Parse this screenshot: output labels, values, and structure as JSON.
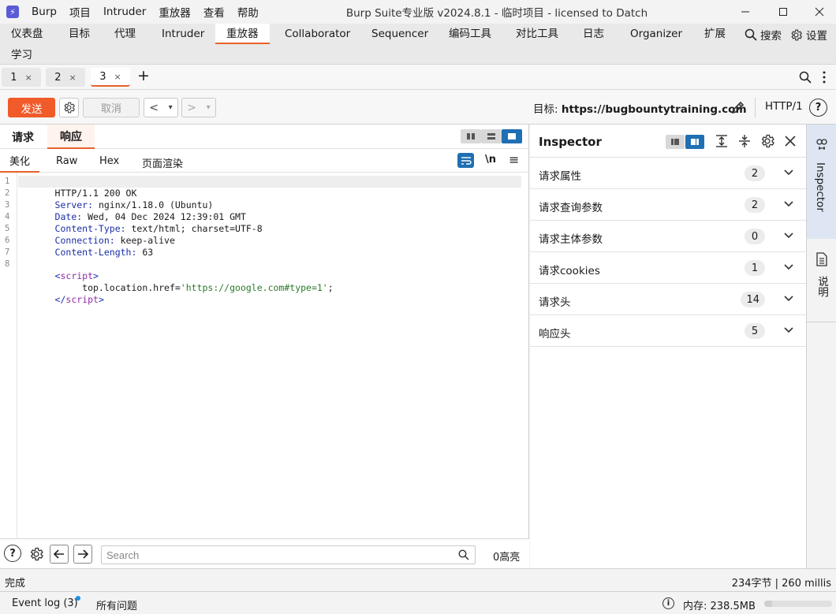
{
  "app": {
    "logo_glyph": "⚡",
    "menu": [
      "Burp",
      "项目",
      "Intruder",
      "重放器",
      "查看",
      "帮助"
    ],
    "window_title": "Burp Suite专业版  v2024.8.1 - 临时项目 - licensed to Datch"
  },
  "tool_tabs": [
    "仪表盘",
    "目标",
    "代理",
    "Intruder",
    "重放器",
    "Collaborator",
    "Sequencer",
    "编码工具",
    "对比工具",
    "日志",
    "Organizer",
    "扩展"
  ],
  "tool_tab_active": "重放器",
  "tool_learn": "学习",
  "search_label": "搜索",
  "settings_label": "设置",
  "repeater_tabs": [
    {
      "label": "1",
      "close": "×"
    },
    {
      "label": "2",
      "close": "×"
    },
    {
      "label": "3",
      "close": "×"
    }
  ],
  "add_tab": "+",
  "toolbar": {
    "send": "发送",
    "cancel": "取消",
    "back": "<",
    "back_menu": "▾",
    "forward": ">",
    "forward_menu": "▾",
    "target_prefix": "目标: ",
    "target_url": "https://bugbountytraining.com",
    "http_version": "HTTP/1",
    "help": "?"
  },
  "message_tabs": {
    "request": "请求",
    "response": "响应",
    "active": "响应"
  },
  "format_tabs": {
    "pretty": "美化",
    "raw": "Raw",
    "hex": "Hex",
    "render": "页面渲染",
    "newline": "\\n",
    "menu": "≡"
  },
  "editor": {
    "line_numbers": [
      "1",
      "2",
      "3",
      "4",
      "5",
      "6",
      "7",
      "8"
    ],
    "lines": [
      {
        "prefix": "HTTP/1.1 200 OK",
        "rest": ""
      },
      {
        "prefix": "Server:",
        "rest": " nginx/1.18.0 (Ubuntu)"
      },
      {
        "prefix": "Date:",
        "rest": " Wed, 04 Dec 2024 12:39:01 GMT"
      },
      {
        "prefix": "Content-Type:",
        "rest": " text/html; charset=UTF-8"
      },
      {
        "prefix": "Connection:",
        "rest": " keep-alive"
      },
      {
        "prefix": "Content-Length:",
        "rest": " 63"
      },
      {
        "prefix": "",
        "rest": ""
      },
      {
        "prefix": "<",
        "tag": "script",
        "suffix": ">"
      },
      {
        "indent": "     top.location.href=",
        "string": "'https://google.com#type=1'",
        "end": ";"
      },
      {
        "prefix": "</",
        "tag": "script",
        "suffix": ">"
      }
    ]
  },
  "search": {
    "placeholder": "Search",
    "highlights": "0高亮"
  },
  "inspector": {
    "title": "Inspector",
    "rows": [
      {
        "label": "请求属性",
        "count": "2"
      },
      {
        "label": "请求查询参数",
        "count": "2"
      },
      {
        "label": "请求主体参数",
        "count": "0"
      },
      {
        "label": "请求cookies",
        "count": "1"
      },
      {
        "label": "请求头",
        "count": "14"
      },
      {
        "label": "响应头",
        "count": "5"
      }
    ]
  },
  "sidebar": {
    "inspector": "Inspector",
    "notes": "说明"
  },
  "status": {
    "left": "完成",
    "right": "234字节 | 260 millis"
  },
  "bottom": {
    "event_log": "Event log (3)",
    "issues": "所有问题",
    "memory": "内存: 238.5MB",
    "memory_fraction": 0.12,
    "info_icon": "i"
  },
  "colors": {
    "accent": "#e8612c",
    "send": "#f15a29",
    "toggle_active": "#1f6fb2",
    "brand": "#5b5bd6"
  }
}
